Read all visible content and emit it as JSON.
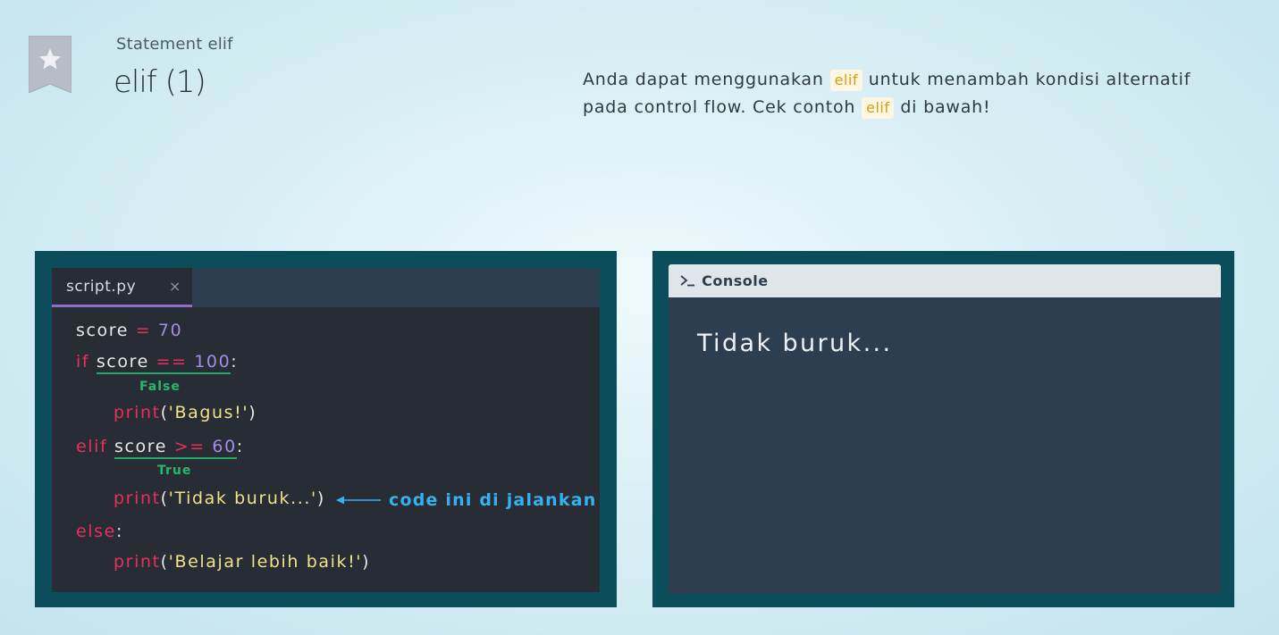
{
  "lesson": {
    "subtitle": "Statement elif",
    "title": "elif (1)"
  },
  "description": {
    "part1": "Anda dapat menggunakan",
    "code1": "elif",
    "part2": "untuk menambah kondisi alternatif pada control flow. Cek contoh",
    "code2": "elif",
    "part3": "di bawah!"
  },
  "editor": {
    "tab_label": "script.py",
    "close_glyph": "×",
    "lines": {
      "l1": {
        "var": "score",
        "op": "=",
        "num": "70"
      },
      "l2": {
        "kw": "if",
        "var": "score",
        "op": "==",
        "num": "100",
        "colon": ":"
      },
      "l3": {
        "fn": "print",
        "open": "(",
        "str": "'Bagus!'",
        "close": ")"
      },
      "l4": {
        "kw": "elif",
        "var": "score",
        "op": ">=",
        "num": "60",
        "colon": ":"
      },
      "l5": {
        "fn": "print",
        "open": "(",
        "str": "'Tidak buruk...'",
        "close": ")"
      },
      "l6": {
        "kw": "else",
        "colon": ":"
      },
      "l7": {
        "fn": "print",
        "open": "(",
        "str": "'Belajar lebih baik!'",
        "close": ")"
      }
    },
    "labels": {
      "false": "False",
      "true": "True"
    },
    "annotation": "code ini di jalankan"
  },
  "console": {
    "title": "Console",
    "prompt_icon": "terminal-prompt-icon",
    "output": "Tidak buruk..."
  },
  "colors": {
    "keyword": "#e8305c",
    "number": "#a48ce8",
    "string": "#f0e28a",
    "condition": "#27b86d",
    "annotation": "#35b1ee",
    "tab_accent": "#8e6ccb",
    "frame": "#0c4d5c"
  }
}
